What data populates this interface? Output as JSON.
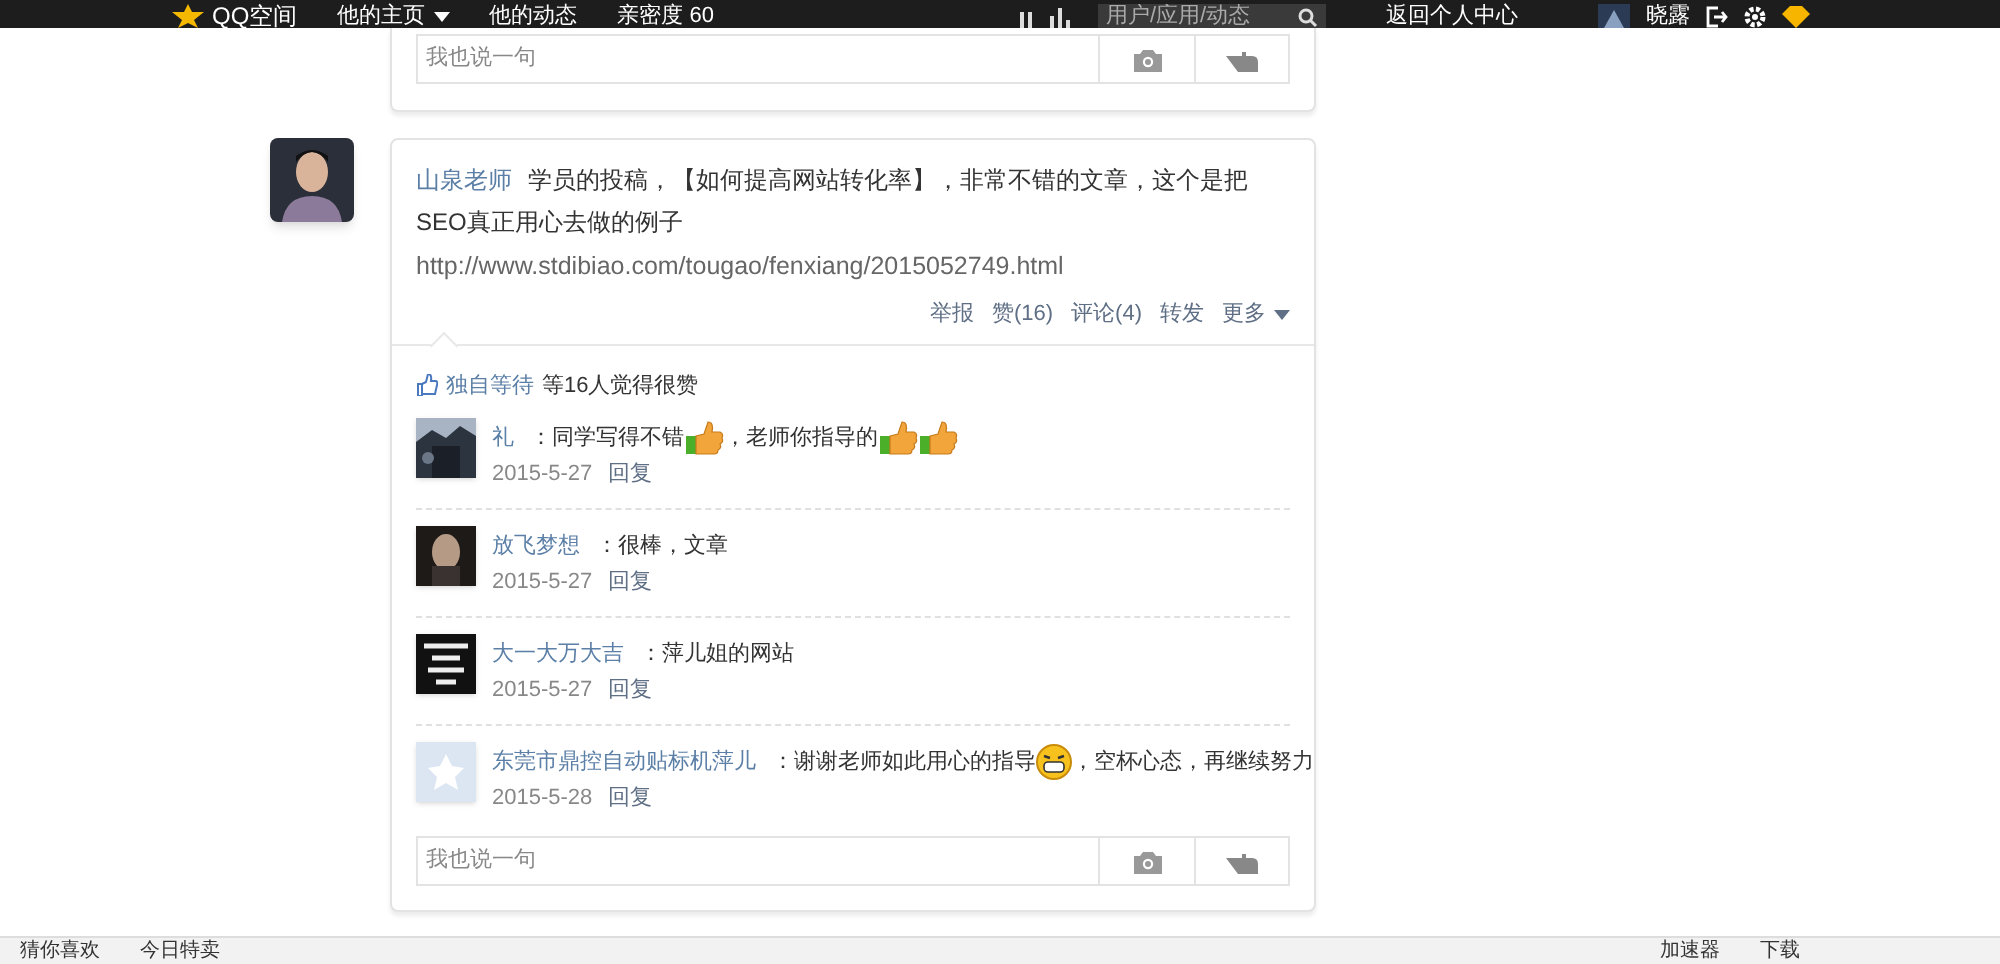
{
  "top_bar": {
    "logo": "QQ空间",
    "nav": [
      {
        "label": "他的主页",
        "caret": true
      },
      {
        "label": "他的动态",
        "caret": false
      },
      {
        "label": "亲密度 60",
        "caret": false
      }
    ],
    "search": {
      "placeholder": "用户/应用/动态"
    },
    "back_link": "返回个人中心",
    "user_name": "晓露"
  },
  "previous_card": {
    "comment_box": {
      "placeholder": "我也说一句"
    }
  },
  "post": {
    "author": "山泉老师",
    "text": "学员的投稿，【如何提高网站转化率】，非常不错的文章，这个是把SEO真正用心去做的例子",
    "link": "http://www.stdibiao.com/tougao/fenxiang/2015052749.html",
    "actions": [
      {
        "label": "举报",
        "caret": false
      },
      {
        "label": "赞(16)",
        "caret": false
      },
      {
        "label": "评论(4)",
        "caret": false
      },
      {
        "label": "转发",
        "caret": false
      },
      {
        "label": "更多",
        "caret": true
      }
    ],
    "likes": {
      "name": "独自等待",
      "text": "等16人觉得很赞"
    },
    "comments": [
      {
        "name": "礼",
        "segments": [
          {
            "kind": "text",
            "text": "：同学写得不错"
          },
          {
            "kind": "thumb"
          },
          {
            "kind": "text",
            "text": "，老师你指导的"
          },
          {
            "kind": "thumb"
          },
          {
            "kind": "thumb"
          }
        ],
        "date": "2015-5-27",
        "reply": "回复"
      },
      {
        "name": "放飞梦想",
        "segments": [
          {
            "kind": "text",
            "text": "：很棒，文章"
          }
        ],
        "date": "2015-5-27",
        "reply": "回复"
      },
      {
        "name": "大一大万大吉",
        "segments": [
          {
            "kind": "text",
            "text": "：萍儿姐的网站"
          }
        ],
        "date": "2015-5-27",
        "reply": "回复"
      },
      {
        "name": "东莞市鼎控自动贴标机萍儿",
        "segments": [
          {
            "kind": "text",
            "text": "：谢谢老师如此用心的指导"
          },
          {
            "kind": "grin"
          },
          {
            "kind": "text",
            "text": "，空杯心态，再继续努力"
          }
        ],
        "date": "2015-5-28",
        "reply": "回复"
      }
    ],
    "comment_box": {
      "placeholder": "我也说一句"
    }
  },
  "bottom_bar": {
    "left": [
      "猜你喜欢",
      "今日特卖"
    ],
    "right": [
      "加速器",
      "下载"
    ]
  }
}
